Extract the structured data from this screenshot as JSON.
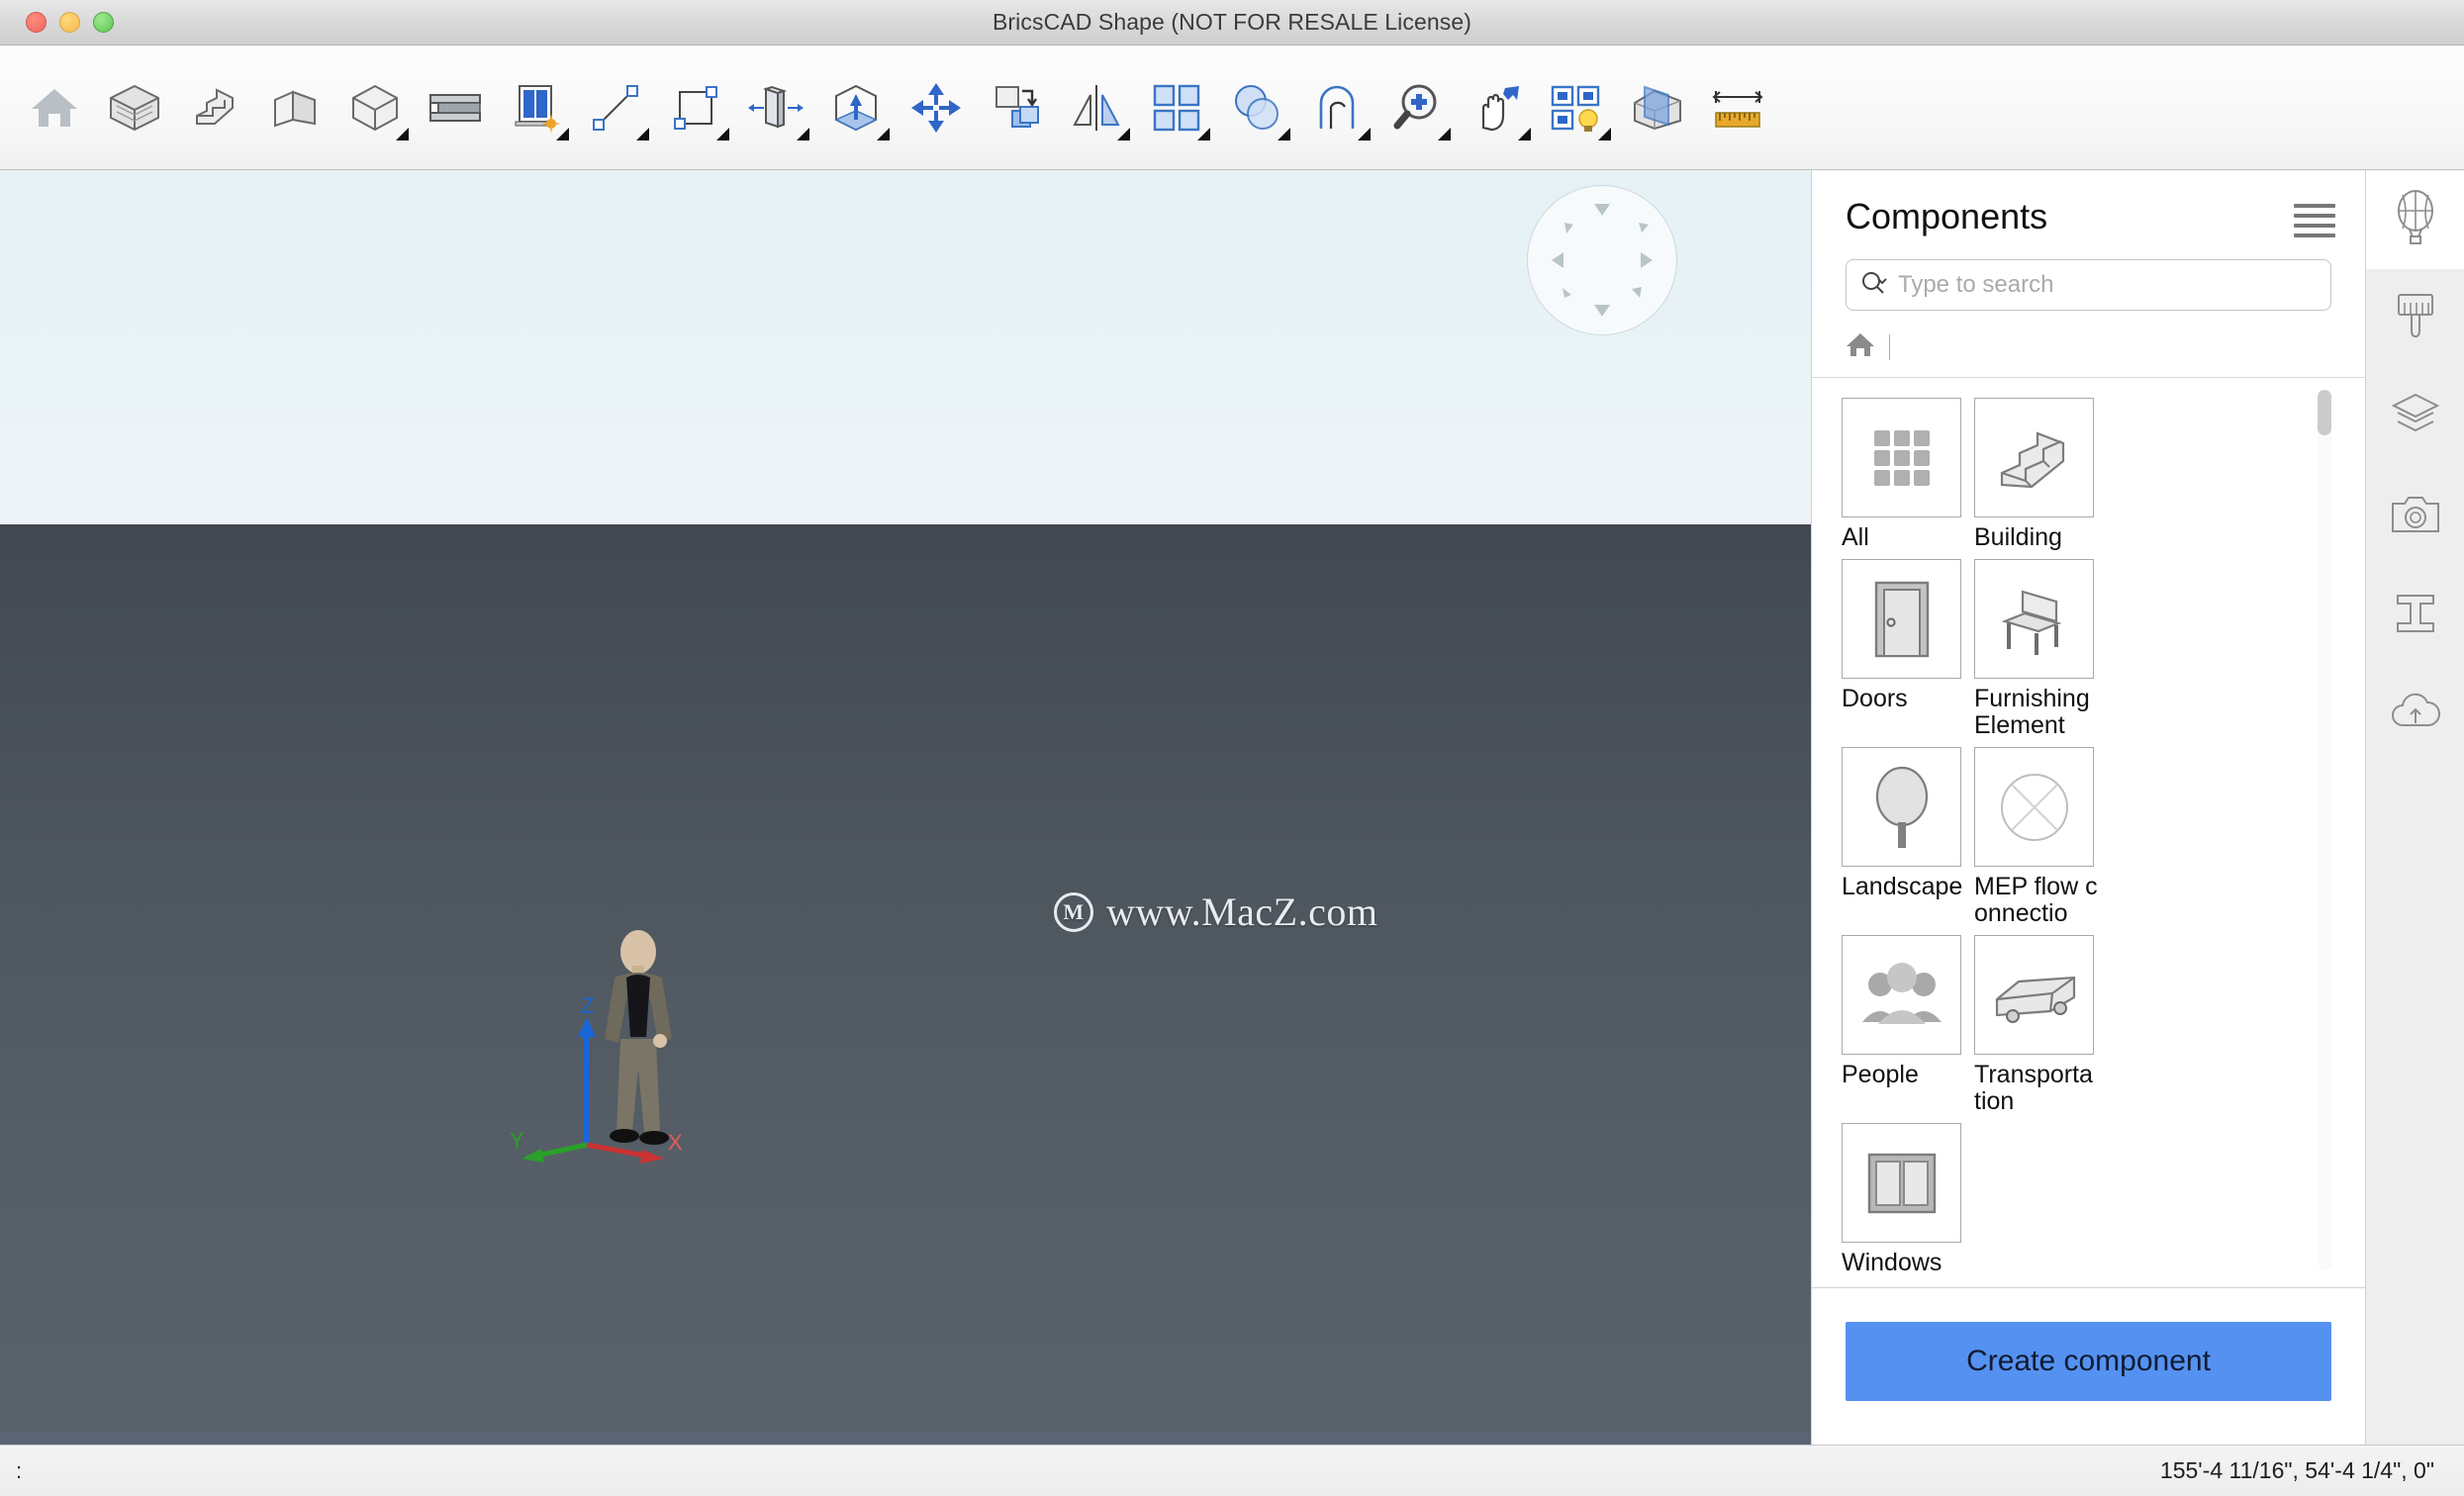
{
  "window": {
    "title": "BricsCAD Shape (NOT FOR RESALE License)",
    "close_label": "close",
    "minimize_label": "minimize",
    "maximize_label": "maximize"
  },
  "toolbar": {
    "items": [
      {
        "name": "home-icon",
        "tooltip": "Home"
      },
      {
        "name": "wall-brick-icon",
        "tooltip": "Wall"
      },
      {
        "name": "stairs-icon",
        "tooltip": "Stairs"
      },
      {
        "name": "slab-icon",
        "tooltip": "Slab"
      },
      {
        "name": "solid-box-icon",
        "tooltip": "Box"
      },
      {
        "name": "beam-icon",
        "tooltip": "Beam"
      },
      {
        "name": "window-insert-icon",
        "tooltip": "Insert Window"
      },
      {
        "name": "line-icon",
        "tooltip": "Line"
      },
      {
        "name": "rectangle-icon",
        "tooltip": "Rectangle"
      },
      {
        "name": "push-pull-icon",
        "tooltip": "Push Pull"
      },
      {
        "name": "extrude-icon",
        "tooltip": "Extrude"
      },
      {
        "name": "move-icon",
        "tooltip": "Move"
      },
      {
        "name": "copy-icon",
        "tooltip": "Copy"
      },
      {
        "name": "mirror-icon",
        "tooltip": "Mirror"
      },
      {
        "name": "array-icon",
        "tooltip": "Array"
      },
      {
        "name": "boolean-union-icon",
        "tooltip": "Union"
      },
      {
        "name": "fillet-icon",
        "tooltip": "Fillet"
      },
      {
        "name": "zoom-icon",
        "tooltip": "Zoom"
      },
      {
        "name": "pan-icon",
        "tooltip": "Pan"
      },
      {
        "name": "visual-style-icon",
        "tooltip": "Visual Styles"
      },
      {
        "name": "section-icon",
        "tooltip": "Section"
      },
      {
        "name": "measure-icon",
        "tooltip": "Measure"
      }
    ]
  },
  "viewport": {
    "lookfrom_name": "lookfrom-widget",
    "axis": {
      "x_label": "X",
      "y_label": "Y",
      "z_label": "Z"
    },
    "model_name": "person-model",
    "watermark": {
      "logo": "M",
      "text": "www.MacZ.com"
    }
  },
  "panel": {
    "title": "Components",
    "menu_label": "panel-menu",
    "search": {
      "value": "",
      "placeholder": "Type to search"
    },
    "breadcrumb": {
      "home_label": "Home"
    },
    "items": [
      {
        "label": "All",
        "icon": "grid-icon"
      },
      {
        "label": "Building",
        "icon": "stairs-icon"
      },
      {
        "label": "Doors",
        "icon": "door-icon"
      },
      {
        "label": "Furnishing Element",
        "icon": "chair-icon"
      },
      {
        "label": "Landscape",
        "icon": "tree-icon"
      },
      {
        "label": "MEP flow connectio",
        "icon": "flow-connection-icon"
      },
      {
        "label": "People",
        "icon": "people-icon"
      },
      {
        "label": "Transportation",
        "icon": "truck-icon"
      },
      {
        "label": "Windows",
        "icon": "window-icon"
      }
    ],
    "create_button": "Create component"
  },
  "rail": {
    "items": [
      {
        "name": "balloon-icon",
        "label": "Components",
        "active": true
      },
      {
        "name": "paintbrush-icon",
        "label": "Materials",
        "active": false
      },
      {
        "name": "layers-icon",
        "label": "Layers",
        "active": false
      },
      {
        "name": "camera-icon",
        "label": "Views",
        "active": false
      },
      {
        "name": "ibeam-icon",
        "label": "Profiles",
        "active": false
      },
      {
        "name": "cloud-upload-icon",
        "label": "Publish",
        "active": false
      }
    ]
  },
  "statusbar": {
    "command_prompt": ":",
    "coordinates": "155'-4 11/16\", 54'-4 1/4\", 0\""
  },
  "colors": {
    "accent": "#5591f0",
    "sky": "#e9f3f6",
    "ground": "#545c65",
    "axis_x": "#cc3333",
    "axis_y": "#2aa02a",
    "axis_z": "#1a66d6"
  }
}
